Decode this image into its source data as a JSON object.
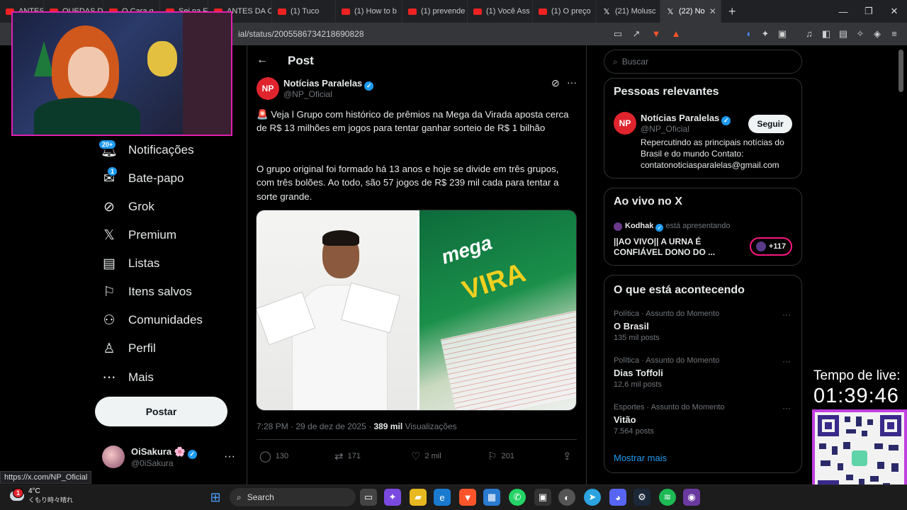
{
  "browser": {
    "tabs": [
      {
        "label": "ANTES DA C",
        "active": false
      },
      {
        "label": "QUEDAS DE",
        "active": false
      },
      {
        "label": "O Cara q",
        "active": false
      },
      {
        "label": "Sei na Fa",
        "active": false
      },
      {
        "label": "ANTES DA C",
        "active": false
      },
      {
        "label": "(1) Tuco",
        "active": false
      },
      {
        "label": "(1) How to b",
        "active": false
      },
      {
        "label": "(1) prevende",
        "active": false
      },
      {
        "label": "(1) Você Ass",
        "active": false
      },
      {
        "label": "(1) O preço",
        "active": false
      },
      {
        "label": "(21) Molusc",
        "active": false
      },
      {
        "label": "(22) No",
        "active": true
      }
    ],
    "url": "ial/status/2005586734218690828",
    "status_url": "https://x.com/NP_Oficial"
  },
  "nav": {
    "items": [
      {
        "label": "Notificações",
        "badge": "20+"
      },
      {
        "label": "Bate-papo",
        "badge": "1"
      },
      {
        "label": "Grok"
      },
      {
        "label": "Premium"
      },
      {
        "label": "Listas"
      },
      {
        "label": "Itens salvos"
      },
      {
        "label": "Comunidades"
      },
      {
        "label": "Perfil"
      },
      {
        "label": "Mais"
      }
    ],
    "post_button": "Postar",
    "account": {
      "name": "OiSakura 🌸",
      "handle": "@0iSakura"
    }
  },
  "post": {
    "header_title": "Post",
    "author": {
      "name": "Notícias Paralelas",
      "handle": "@NP_Oficial",
      "logo": "NP"
    },
    "text_1": "🚨 Veja l Grupo com histórico de prêmios na Mega da Virada aposta cerca de R$ 13 milhões em jogos para tentar ganhar sorteio de R$ 1 bilhão",
    "text_2": "O grupo original foi formado há 13 anos e hoje se divide em três grupos, com três bolões. Ao todo, são 57 jogos de R$ 239 mil cada para tentar a sorte grande.",
    "image_right_text_1": "mega",
    "image_right_text_2": "VIRA",
    "meta_time": "7:28 PM · 29 de dez de 2025 · ",
    "meta_views": "389 mil",
    "meta_views_label": " Visualizações",
    "actions": {
      "replies": "130",
      "reposts": "171",
      "likes": "2 mil",
      "bookmarks": "201"
    }
  },
  "sidebar": {
    "search_placeholder": "Buscar",
    "relevant": {
      "title": "Pessoas relevantes",
      "name": "Notícias Paralelas",
      "handle": "@NP_Oficial",
      "follow": "Seguir",
      "bio": "Repercutindo as principais notícias do Brasil e do mundo Contato: contatonoticiasparalelas@gmail.com"
    },
    "live": {
      "title": "Ao vivo no X",
      "host": "Kodhak",
      "host_status": " está apresentando",
      "stream_title": "||AO VIVO|| A URNA É CONFIÁVEL DONO DO ...",
      "count": "+117"
    },
    "trends": {
      "title": "O que está acontecendo",
      "items": [
        {
          "category": "Política · Assunto do Momento",
          "name": "O Brasil",
          "count": "135 mil posts"
        },
        {
          "category": "Política · Assunto do Momento",
          "name": "Dias Toffoli",
          "count": "12,6 mil posts"
        },
        {
          "category": "Esportes · Assunto do Momento",
          "name": "Vitão",
          "count": "7.564 posts"
        }
      ],
      "show_more": "Mostrar mais"
    }
  },
  "overlay": {
    "live_label": "Tempo de live:",
    "live_time": "01:39:46"
  },
  "taskbar": {
    "temperature": "4°C",
    "condition": "くもり時々晴れ",
    "search": "Search",
    "weather_badge": "1"
  },
  "colors": {
    "accent": "#1d9bf0",
    "np_red": "#e0242e",
    "live_pink": "#f91880",
    "stream_border": "#e020b0"
  }
}
